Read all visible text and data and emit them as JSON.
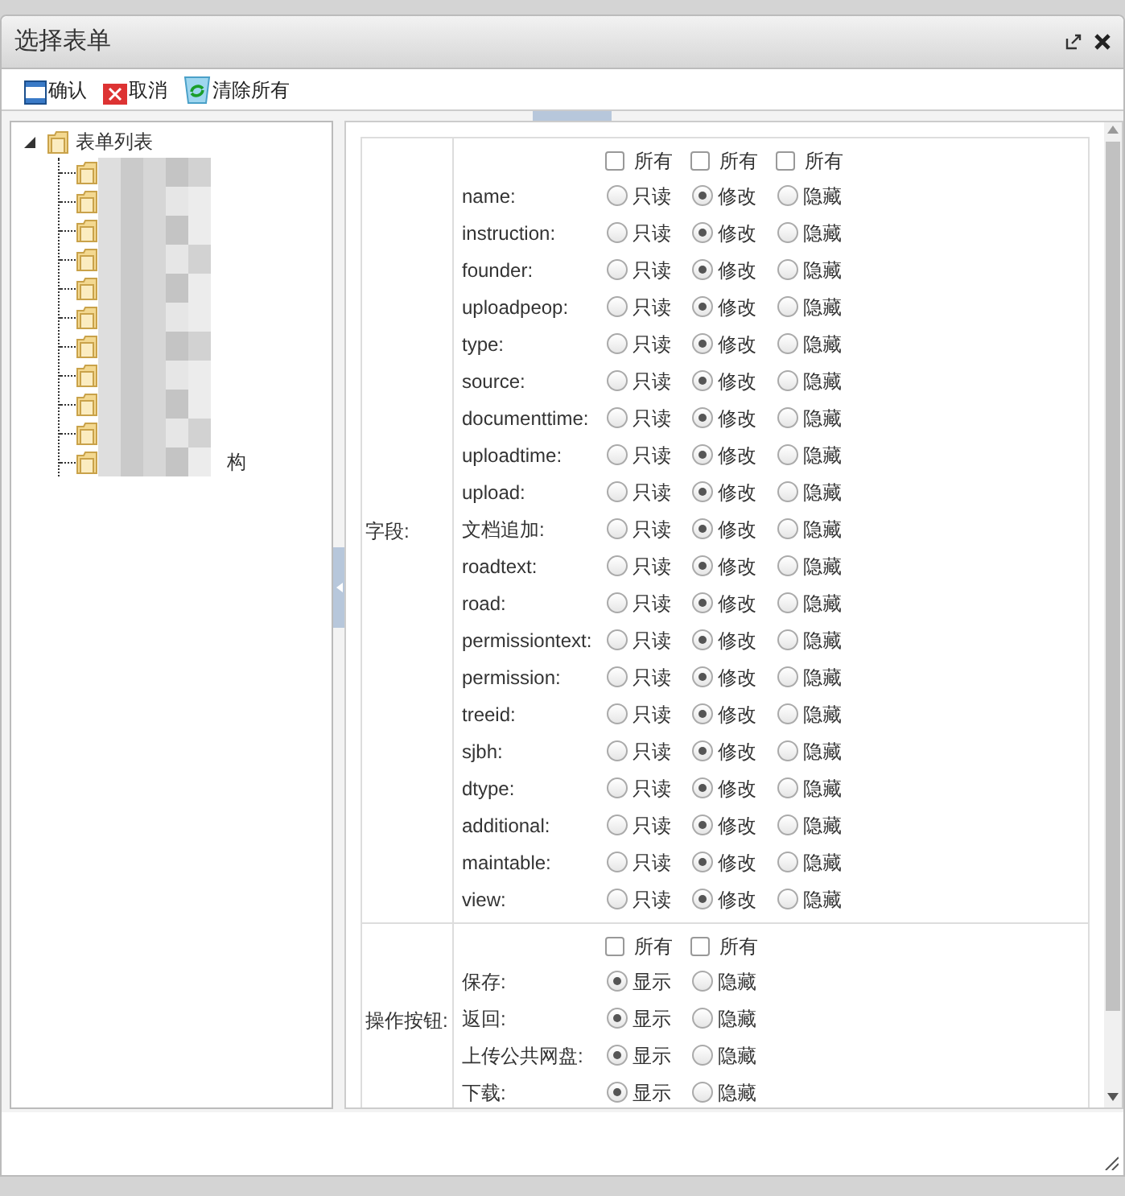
{
  "window": {
    "title": "选择表单"
  },
  "toolbar": [
    {
      "kind": "save",
      "label": "确认"
    },
    {
      "kind": "cancel",
      "label": "取消"
    },
    {
      "kind": "clear",
      "label": "清除所有"
    }
  ],
  "tree": {
    "label": "表单列表",
    "expanded": true,
    "children": [
      {
        "kind": "blurred"
      },
      {
        "kind": "blurred"
      },
      {
        "kind": "blurred"
      },
      {
        "kind": "blurred"
      },
      {
        "kind": "blurred"
      },
      {
        "kind": "blurred"
      },
      {
        "kind": "blurred"
      },
      {
        "kind": "blurred"
      },
      {
        "kind": "blurred"
      },
      {
        "kind": "blurred"
      },
      {
        "kind": "blurred",
        "tail": "构"
      }
    ]
  },
  "sections": [
    {
      "label": "字段:",
      "all": [
        {
          "label": "所有",
          "checked": false
        },
        {
          "label": "所有",
          "checked": false
        },
        {
          "label": "所有",
          "checked": false
        }
      ],
      "rows": [
        {
          "label": "name:",
          "options": [
            {
              "label": "只读",
              "selected": false
            },
            {
              "label": "修改",
              "selected": true
            },
            {
              "label": "隐藏",
              "selected": false
            }
          ]
        },
        {
          "label": "instruction:",
          "options": [
            {
              "label": "只读",
              "selected": false
            },
            {
              "label": "修改",
              "selected": true
            },
            {
              "label": "隐藏",
              "selected": false
            }
          ]
        },
        {
          "label": "founder:",
          "options": [
            {
              "label": "只读",
              "selected": false
            },
            {
              "label": "修改",
              "selected": true
            },
            {
              "label": "隐藏",
              "selected": false
            }
          ]
        },
        {
          "label": "uploadpeop:",
          "options": [
            {
              "label": "只读",
              "selected": false
            },
            {
              "label": "修改",
              "selected": true
            },
            {
              "label": "隐藏",
              "selected": false
            }
          ]
        },
        {
          "label": "type:",
          "options": [
            {
              "label": "只读",
              "selected": false
            },
            {
              "label": "修改",
              "selected": true
            },
            {
              "label": "隐藏",
              "selected": false
            }
          ]
        },
        {
          "label": "source:",
          "options": [
            {
              "label": "只读",
              "selected": false
            },
            {
              "label": "修改",
              "selected": true
            },
            {
              "label": "隐藏",
              "selected": false
            }
          ]
        },
        {
          "label": "documenttime:",
          "options": [
            {
              "label": "只读",
              "selected": false
            },
            {
              "label": "修改",
              "selected": true
            },
            {
              "label": "隐藏",
              "selected": false
            }
          ]
        },
        {
          "label": "uploadtime:",
          "options": [
            {
              "label": "只读",
              "selected": false
            },
            {
              "label": "修改",
              "selected": true
            },
            {
              "label": "隐藏",
              "selected": false
            }
          ]
        },
        {
          "label": "upload:",
          "options": [
            {
              "label": "只读",
              "selected": false
            },
            {
              "label": "修改",
              "selected": true
            },
            {
              "label": "隐藏",
              "selected": false
            }
          ]
        },
        {
          "label": "文档追加:",
          "options": [
            {
              "label": "只读",
              "selected": false
            },
            {
              "label": "修改",
              "selected": true
            },
            {
              "label": "隐藏",
              "selected": false
            }
          ]
        },
        {
          "label": "roadtext:",
          "options": [
            {
              "label": "只读",
              "selected": false
            },
            {
              "label": "修改",
              "selected": true
            },
            {
              "label": "隐藏",
              "selected": false
            }
          ]
        },
        {
          "label": "road:",
          "options": [
            {
              "label": "只读",
              "selected": false
            },
            {
              "label": "修改",
              "selected": true
            },
            {
              "label": "隐藏",
              "selected": false
            }
          ]
        },
        {
          "label": "permissiontext:",
          "options": [
            {
              "label": "只读",
              "selected": false
            },
            {
              "label": "修改",
              "selected": true
            },
            {
              "label": "隐藏",
              "selected": false
            }
          ]
        },
        {
          "label": "permission:",
          "options": [
            {
              "label": "只读",
              "selected": false
            },
            {
              "label": "修改",
              "selected": true
            },
            {
              "label": "隐藏",
              "selected": false
            }
          ]
        },
        {
          "label": "treeid:",
          "options": [
            {
              "label": "只读",
              "selected": false
            },
            {
              "label": "修改",
              "selected": true
            },
            {
              "label": "隐藏",
              "selected": false
            }
          ]
        },
        {
          "label": "sjbh:",
          "options": [
            {
              "label": "只读",
              "selected": false
            },
            {
              "label": "修改",
              "selected": true
            },
            {
              "label": "隐藏",
              "selected": false
            }
          ]
        },
        {
          "label": "dtype:",
          "options": [
            {
              "label": "只读",
              "selected": false
            },
            {
              "label": "修改",
              "selected": true
            },
            {
              "label": "隐藏",
              "selected": false
            }
          ]
        },
        {
          "label": "additional:",
          "options": [
            {
              "label": "只读",
              "selected": false
            },
            {
              "label": "修改",
              "selected": true
            },
            {
              "label": "隐藏",
              "selected": false
            }
          ]
        },
        {
          "label": "maintable:",
          "options": [
            {
              "label": "只读",
              "selected": false
            },
            {
              "label": "修改",
              "selected": true
            },
            {
              "label": "隐藏",
              "selected": false
            }
          ]
        },
        {
          "label": "view:",
          "options": [
            {
              "label": "只读",
              "selected": false
            },
            {
              "label": "修改",
              "selected": true
            },
            {
              "label": "隐藏",
              "selected": false
            }
          ]
        }
      ]
    },
    {
      "label": "操作按钮:",
      "all": [
        {
          "label": "所有",
          "checked": false
        },
        {
          "label": "所有",
          "checked": false
        }
      ],
      "rows": [
        {
          "label": "保存:",
          "options": [
            {
              "label": "显示",
              "selected": true
            },
            {
              "label": "隐藏",
              "selected": false
            }
          ]
        },
        {
          "label": "返回:",
          "options": [
            {
              "label": "显示",
              "selected": true
            },
            {
              "label": "隐藏",
              "selected": false
            }
          ]
        },
        {
          "label": "上传公共网盘:",
          "options": [
            {
              "label": "显示",
              "selected": true
            },
            {
              "label": "隐藏",
              "selected": false
            }
          ]
        },
        {
          "label": "下载:",
          "options": [
            {
              "label": "显示",
              "selected": true
            },
            {
              "label": "隐藏",
              "selected": false
            }
          ]
        }
      ]
    }
  ]
}
